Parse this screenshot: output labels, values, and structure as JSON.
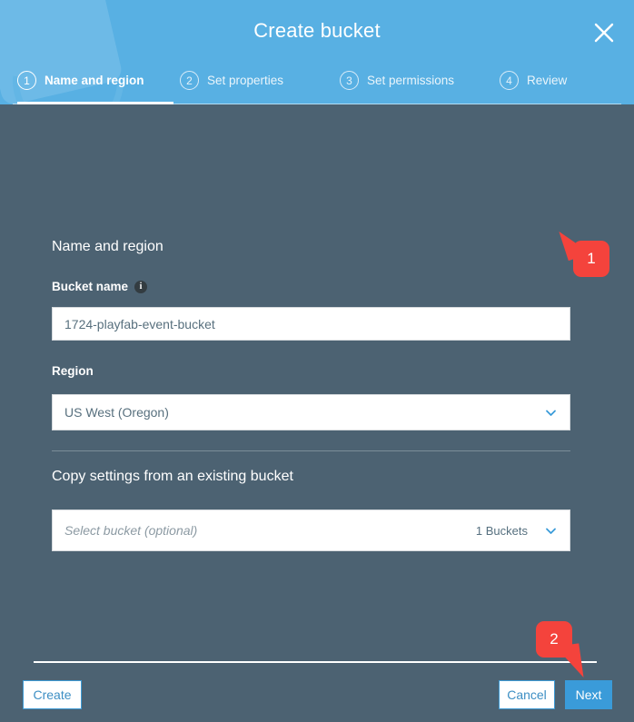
{
  "header": {
    "title": "Create bucket",
    "close_label": "×",
    "steps": [
      {
        "num": "1",
        "label": "Name and region",
        "active": true
      },
      {
        "num": "2",
        "label": "Set properties",
        "active": false
      },
      {
        "num": "3",
        "label": "Set permissions",
        "active": false
      },
      {
        "num": "4",
        "label": "Review",
        "active": false
      }
    ]
  },
  "form": {
    "section_title": "Name and region",
    "bucket_name_label": "Bucket name",
    "bucket_name_info": "i",
    "bucket_name_value": "1724-playfab-event-bucket",
    "region_label": "Region",
    "region_value": "US West (Oregon)",
    "copy_settings_title": "Copy settings from an existing bucket",
    "copy_settings_placeholder": "Select bucket (optional)",
    "copy_settings_count": "1 Buckets"
  },
  "footer": {
    "create_label": "Create",
    "cancel_label": "Cancel",
    "next_label": "Next"
  },
  "callouts": [
    {
      "number": "1"
    },
    {
      "number": "2"
    }
  ],
  "colors": {
    "header_blue": "#58b0e3",
    "body_slate": "#4c6272",
    "accent_blue": "#3a9bd9",
    "callout_red": "#f4433c"
  }
}
